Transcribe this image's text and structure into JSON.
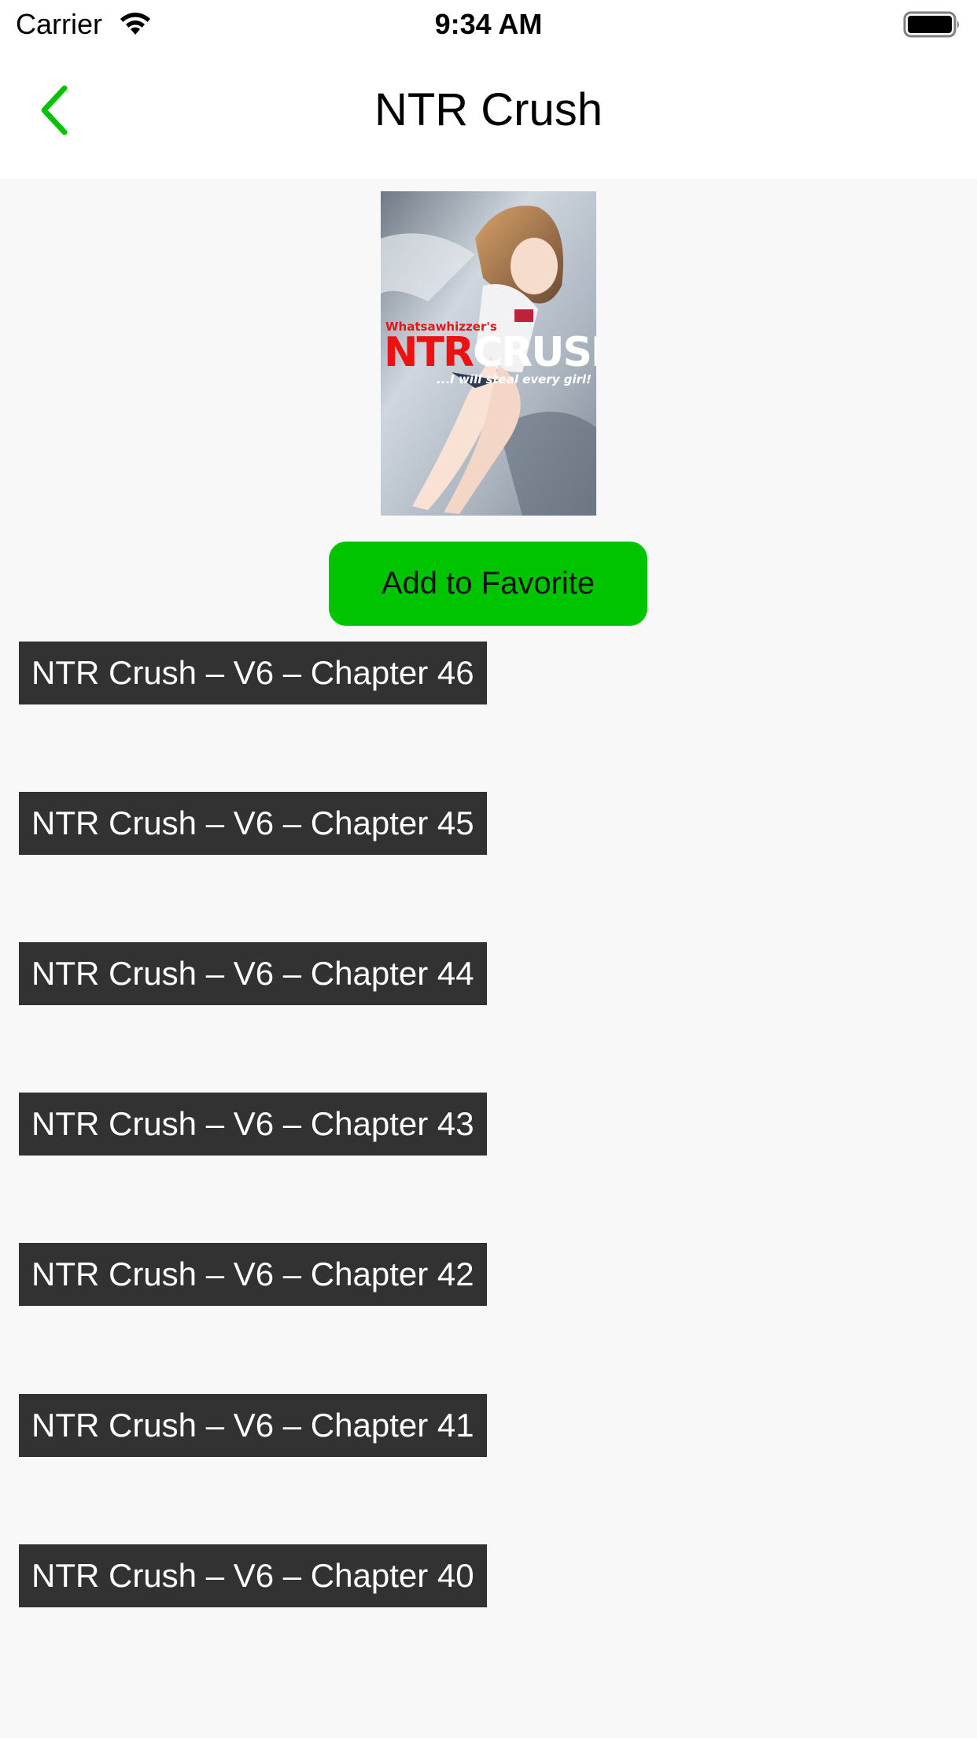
{
  "status_bar": {
    "carrier": "Carrier",
    "time": "9:34 AM"
  },
  "nav": {
    "title": "NTR Crush",
    "back_icon": "chevron-left-icon",
    "accent_color": "#00c400"
  },
  "cover": {
    "author_text": "Whatsawhizzer's",
    "title_part1": "NTR",
    "title_part2": "CRUSH",
    "tagline": "...I will steal every girl!"
  },
  "favorite_button": {
    "label": "Add to Favorite"
  },
  "chapters": [
    {
      "label": "NTR Crush – V6 – Chapter 46"
    },
    {
      "label": "NTR Crush – V6 – Chapter 45"
    },
    {
      "label": "NTR Crush – V6 – Chapter 44"
    },
    {
      "label": "NTR Crush – V6 – Chapter 43"
    },
    {
      "label": "NTR Crush – V6 – Chapter 42"
    },
    {
      "label": "NTR Crush – V6 – Chapter 41"
    },
    {
      "label": "NTR Crush – V6 – Chapter 40"
    }
  ]
}
